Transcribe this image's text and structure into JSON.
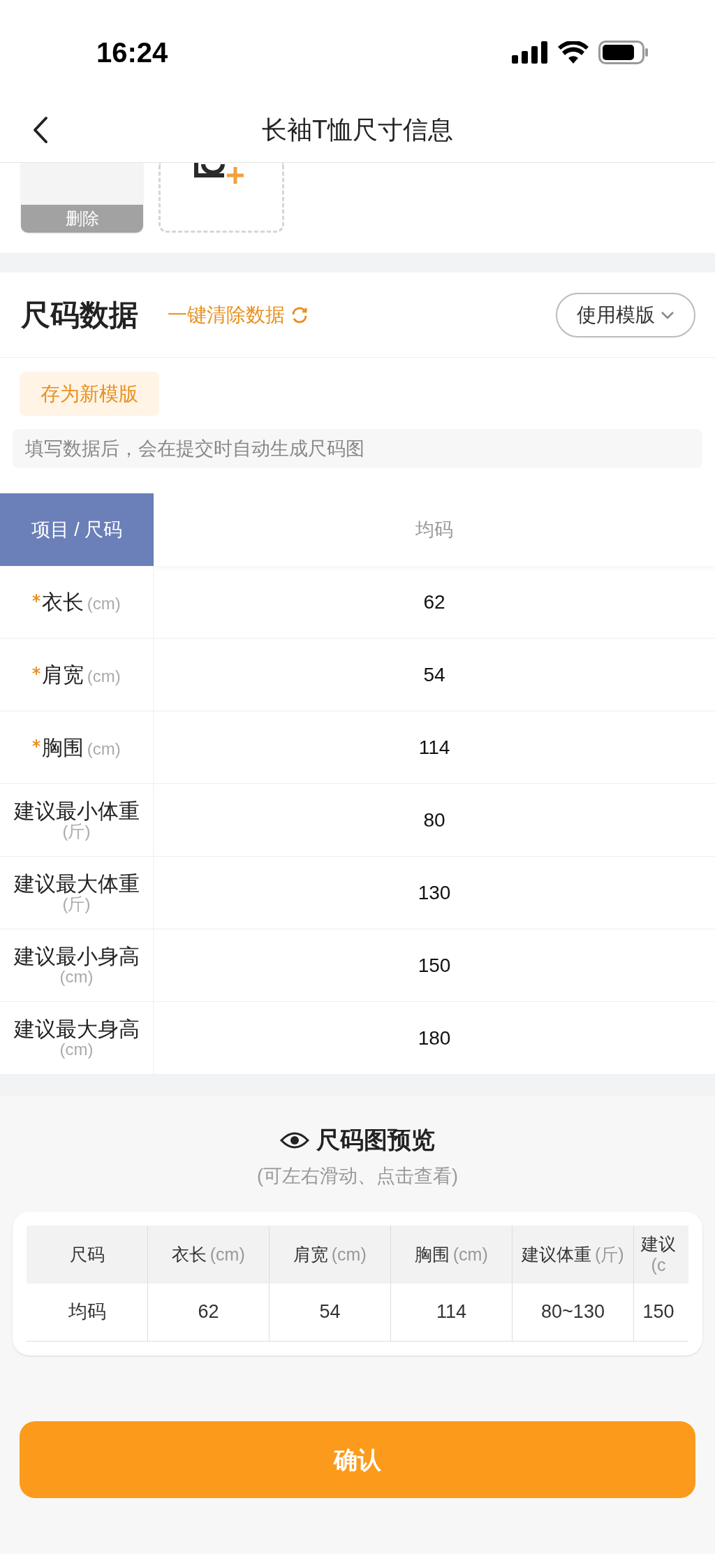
{
  "status_bar": {
    "time": "16:24"
  },
  "nav": {
    "title": "长袖T恤尺寸信息"
  },
  "photos": {
    "delete_label": "删除"
  },
  "size_data": {
    "title": "尺码数据",
    "clear_action": "一键清除数据",
    "template_button": "使用模版",
    "save_template_button": "存为新模版",
    "hint": "填写数据后，会在提交时自动生成尺码图"
  },
  "table": {
    "corner": "项目 / 尺码",
    "columns": [
      "均码"
    ],
    "rows": [
      {
        "label": "衣长",
        "unit": "(cm)",
        "required": true,
        "values": [
          "62"
        ]
      },
      {
        "label": "肩宽",
        "unit": "(cm)",
        "required": true,
        "values": [
          "54"
        ]
      },
      {
        "label": "胸围",
        "unit": "(cm)",
        "required": true,
        "values": [
          "114"
        ]
      },
      {
        "label": "建议最小体重",
        "unit": "(斤)",
        "required": false,
        "values": [
          "80"
        ]
      },
      {
        "label": "建议最大体重",
        "unit": "(斤)",
        "required": false,
        "values": [
          "130"
        ]
      },
      {
        "label": "建议最小身高",
        "unit": "(cm)",
        "required": false,
        "values": [
          "150"
        ]
      },
      {
        "label": "建议最大身高",
        "unit": "(cm)",
        "required": false,
        "values": [
          "180"
        ]
      }
    ]
  },
  "preview": {
    "title": "尺码图预览",
    "subtitle": "(可左右滑动、点击查看)",
    "columns": [
      {
        "label": "尺码"
      },
      {
        "label": "衣长",
        "unit": "(cm)"
      },
      {
        "label": "肩宽",
        "unit": "(cm)"
      },
      {
        "label": "胸围",
        "unit": "(cm)"
      },
      {
        "label": "建议体重",
        "unit": "(斤)"
      },
      {
        "label": "建议",
        "unit": "(c"
      }
    ],
    "rows": [
      [
        "均码",
        "62",
        "54",
        "114",
        "80~130",
        "150"
      ]
    ]
  },
  "confirm_button": "确认"
}
